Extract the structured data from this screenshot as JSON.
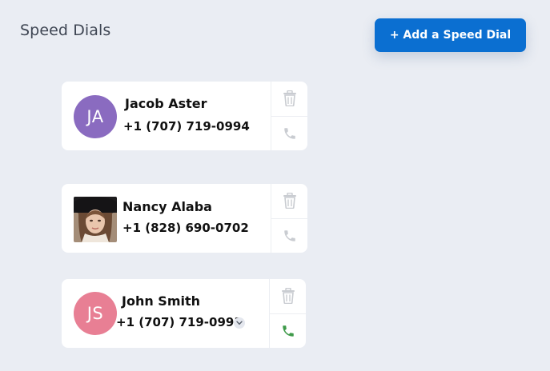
{
  "header": {
    "title": "Speed Dials",
    "add_button_label": "+ Add a Speed Dial"
  },
  "speed_dials": [
    {
      "name": "Jacob Aster",
      "phone": "+1 (707) 719-0994",
      "avatar_initials": "JA",
      "avatar_color": "#8a6bc0",
      "call_icon_color": "#c9ccd1"
    },
    {
      "name": "Nancy Alaba",
      "phone": "+1 (828) 690-0702",
      "avatar_type": "photo",
      "call_icon_color": "#c9ccd1"
    },
    {
      "name": "John Smith",
      "phone": "+1 (707) 719-0993",
      "avatar_initials": "JS",
      "avatar_color": "#e87f94",
      "call_icon_color": "#3f9a4a",
      "has_number_dropdown": true
    }
  ],
  "icons": {
    "delete": "trash-icon",
    "call": "phone-icon",
    "dropdown": "chevron-down-icon"
  }
}
